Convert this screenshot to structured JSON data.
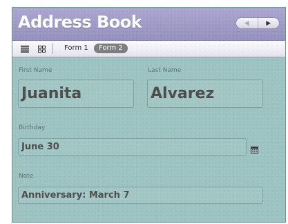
{
  "header": {
    "title": "Address Book",
    "nav": {
      "prev_icon": "triangle-left-icon",
      "next_icon": "triangle-right-icon"
    }
  },
  "toolbar": {
    "list_view_icon": "list-view-icon",
    "grid_view_icon": "grid-view-icon",
    "tabs": [
      {
        "label": "Form 1",
        "selected": false
      },
      {
        "label": "Form 2",
        "selected": true
      }
    ]
  },
  "form": {
    "first_name": {
      "label": "First Name",
      "value": "Juanita"
    },
    "last_name": {
      "label": "Last Name",
      "value": "Alvarez"
    },
    "birthday": {
      "label": "Birthday",
      "value": "June 30",
      "picker_icon": "calendar-icon"
    },
    "note": {
      "label": "Note",
      "value": "Anniversary: March 7"
    }
  },
  "colors": {
    "header": "#9e9ac6",
    "background": "#9cc3c1",
    "selected_tab": "#7d7d7d"
  }
}
